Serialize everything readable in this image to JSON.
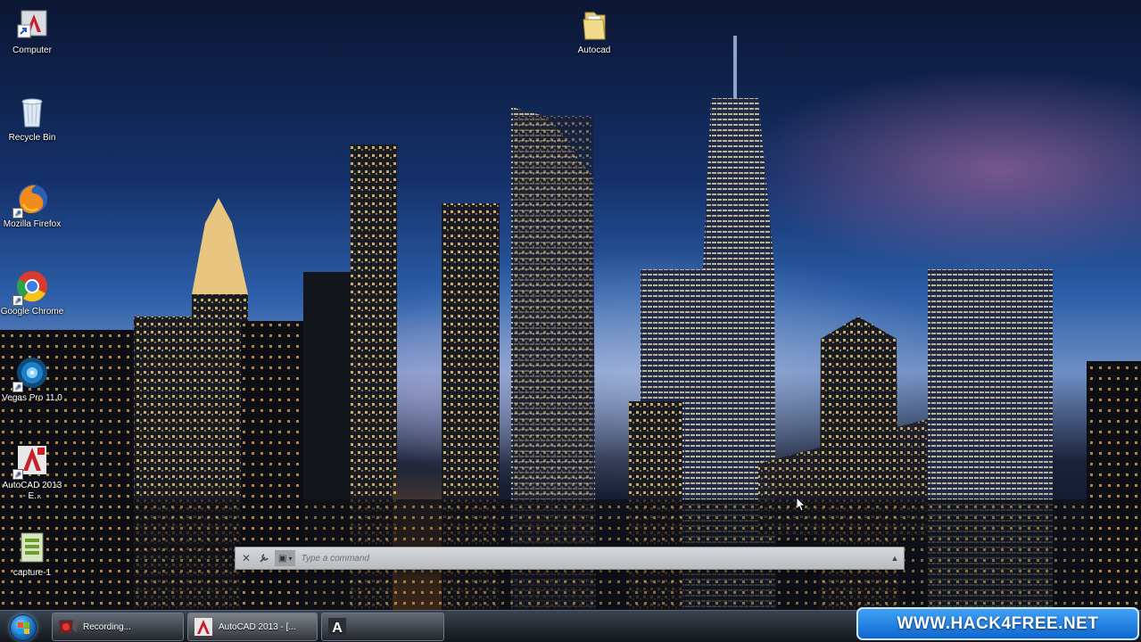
{
  "desktop": {
    "icons": [
      {
        "label": "Computer",
        "icon": "computer-icon"
      },
      {
        "label": "Recycle Bin",
        "icon": "recycle-bin-icon"
      },
      {
        "label": "Mozilla Firefox",
        "icon": "firefox-icon"
      },
      {
        "label": "Google Chrome",
        "icon": "chrome-icon"
      },
      {
        "label": "Vegas Pro 11.0",
        "icon": "vegas-pro-icon"
      },
      {
        "label": "AutoCAD 2013 - E...",
        "icon": "autocad-icon"
      },
      {
        "label": "capture-1",
        "icon": "file-icon"
      },
      {
        "label": "Autocad",
        "icon": "folder-icon"
      }
    ]
  },
  "command_line": {
    "placeholder": "Type a command"
  },
  "taskbar": {
    "buttons": [
      {
        "label": "Recording...",
        "icon": "recording-icon"
      },
      {
        "label": "AutoCAD 2013 - [...",
        "icon": "autocad-icon"
      },
      {
        "label": "",
        "icon": "autocad-text-icon"
      }
    ]
  },
  "watermark": {
    "text": "WWW.HACK4FREE.NET"
  },
  "colors": {
    "watermark_blue": "#1f7fe0",
    "autocad_red": "#c8202a",
    "taskbar_dark": "#1a1f27"
  }
}
